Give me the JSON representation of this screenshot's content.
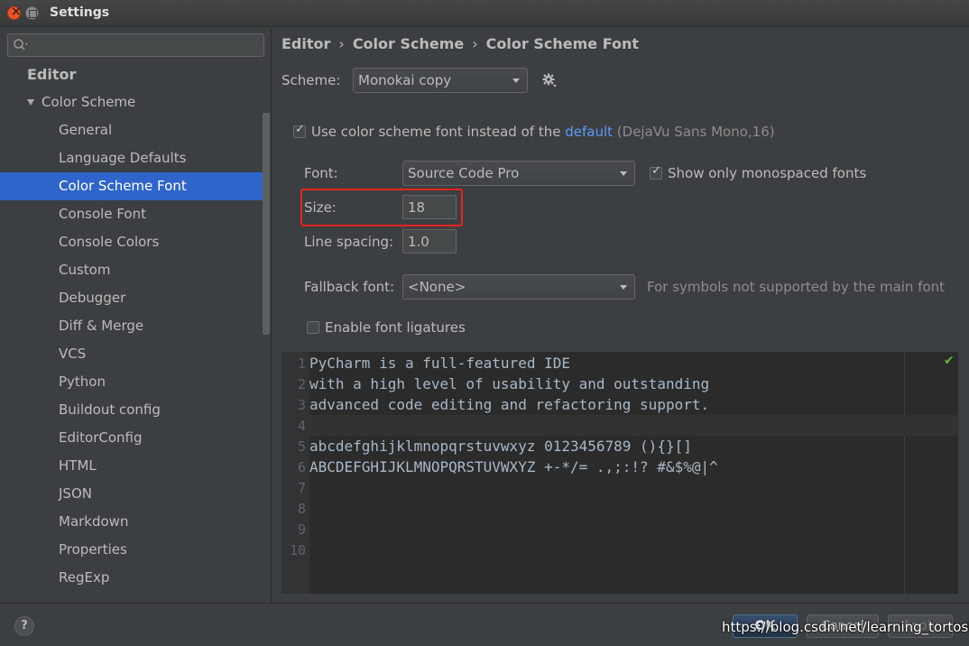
{
  "window": {
    "title": "Settings"
  },
  "search": {
    "placeholder": "",
    "value": ""
  },
  "sidebar": {
    "section": "Editor",
    "group": "Color Scheme",
    "items": [
      {
        "label": "General"
      },
      {
        "label": "Language Defaults"
      },
      {
        "label": "Color Scheme Font",
        "selected": true
      },
      {
        "label": "Console Font"
      },
      {
        "label": "Console Colors"
      },
      {
        "label": "Custom"
      },
      {
        "label": "Debugger"
      },
      {
        "label": "Diff & Merge"
      },
      {
        "label": "VCS"
      },
      {
        "label": "Python"
      },
      {
        "label": "Buildout config"
      },
      {
        "label": "EditorConfig"
      },
      {
        "label": "HTML"
      },
      {
        "label": "JSON"
      },
      {
        "label": "Markdown"
      },
      {
        "label": "Properties"
      },
      {
        "label": "RegExp"
      }
    ]
  },
  "breadcrumb": [
    "Editor",
    "Color Scheme",
    "Color Scheme Font"
  ],
  "breadcrumb_sep": "›",
  "scheme": {
    "label": "Scheme:",
    "value": "Monokai copy"
  },
  "use_scheme_font": {
    "checked": true,
    "text_before": "Use color scheme font instead of the",
    "link": "default",
    "text_after": "(DejaVu Sans Mono,16)"
  },
  "font": {
    "label": "Font:",
    "value": "Source Code Pro"
  },
  "monospaced": {
    "checked": true,
    "label": "Show only monospaced fonts"
  },
  "size": {
    "label": "Size:",
    "value": "18"
  },
  "line_spacing": {
    "label": "Line spacing:",
    "value": "1.0"
  },
  "fallback": {
    "label": "Fallback font:",
    "value": "<None>",
    "hint": "For symbols not supported by the main font"
  },
  "ligatures": {
    "checked": false,
    "label": "Enable font ligatures"
  },
  "preview": {
    "lines": [
      {
        "n": "1",
        "text": "PyCharm is a full-featured IDE"
      },
      {
        "n": "2",
        "text": "with a high level of usability and outstanding"
      },
      {
        "n": "3",
        "text": "advanced code editing and refactoring support."
      },
      {
        "n": "4",
        "text": ""
      },
      {
        "n": "5",
        "text": "abcdefghijklmnopqrstuvwxyz 0123456789 (){}[]"
      },
      {
        "n": "6",
        "text": "ABCDEFGHIJKLMNOPQRSTUVWXYZ +-*/= .,;:!? #&$%@|^"
      },
      {
        "n": "7",
        "text": ""
      },
      {
        "n": "8",
        "text": ""
      },
      {
        "n": "9",
        "text": ""
      },
      {
        "n": "10",
        "text": ""
      }
    ],
    "current_line": 4
  },
  "buttons": {
    "help": "?",
    "ok": "OK",
    "cancel": "Cancel",
    "apply": "Apply"
  },
  "watermark": "https://blog.csdn.net/learning_tortosie",
  "colors": {
    "selection": "#2f65ca",
    "link": "#589df6",
    "highlight": "#e8231d",
    "background": "#3c3f41",
    "editor_bg": "#2b2b2b"
  }
}
